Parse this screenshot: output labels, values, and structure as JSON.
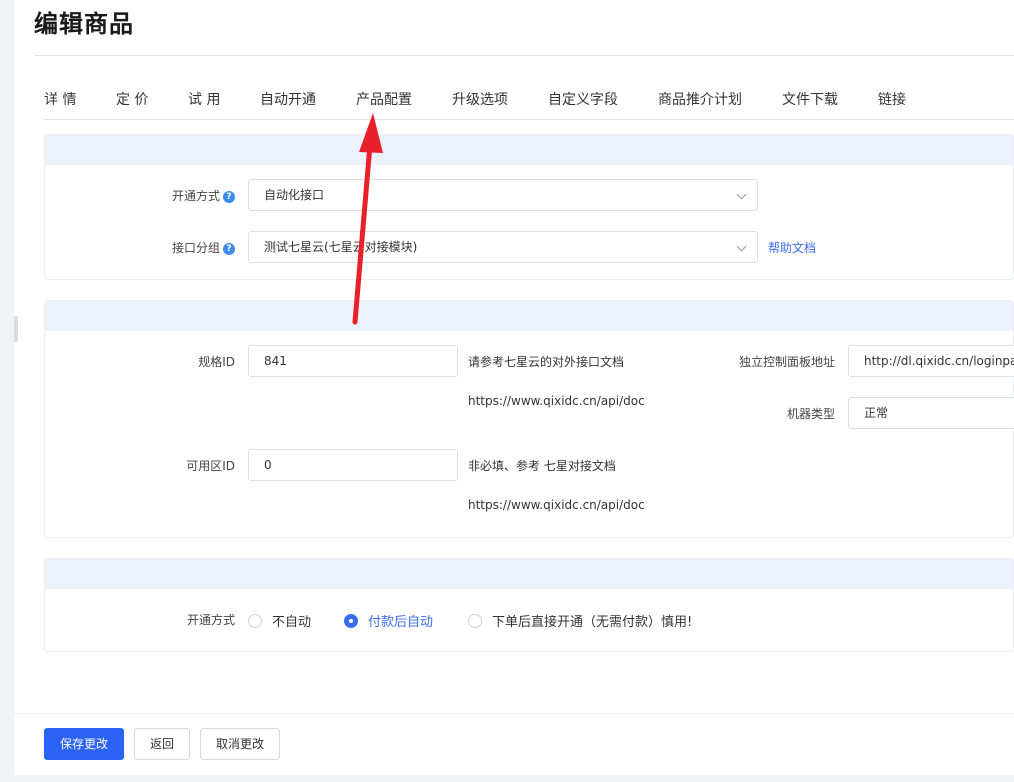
{
  "page": {
    "title": "编辑商品"
  },
  "tabs": [
    {
      "label": "详 情"
    },
    {
      "label": "定 价"
    },
    {
      "label": "试 用"
    },
    {
      "label": "自动开通",
      "active": true
    },
    {
      "label": "产品配置"
    },
    {
      "label": "升级选项"
    },
    {
      "label": "自定义字段"
    },
    {
      "label": "商品推介计划"
    },
    {
      "label": "文件下载"
    },
    {
      "label": "链接"
    }
  ],
  "section1": {
    "open_method": {
      "label": "开通方式",
      "value": "自动化接口"
    },
    "api_group": {
      "label": "接口分组",
      "value": "测试七星云(七星云对接模块)",
      "help_link": "帮助文档"
    }
  },
  "section2": {
    "spec_id": {
      "label": "规格ID",
      "value": "841",
      "note": "请参考七星云的对外接口文档",
      "url": "https://www.qixidc.cn/api/doc"
    },
    "zone_id": {
      "label": "可用区ID",
      "value": "0",
      "note": "非必填、参考 七星对接文档",
      "url": "https://www.qixidc.cn/api/doc"
    },
    "panel_url": {
      "label": "独立控制面板地址",
      "value": "http://dl.qixidc.cn/loginpanel"
    },
    "machine_type": {
      "label": "机器类型",
      "value": "正常"
    }
  },
  "section3": {
    "label": "开通方式",
    "options": [
      "不自动",
      "付款后自动",
      "下单后直接开通（无需付款）慎用!"
    ],
    "selected": 1
  },
  "footer": {
    "save": "保存更改",
    "back": "返回",
    "cancel": "取消更改"
  },
  "colors": {
    "accent": "#3b6cf2",
    "primary_button": "#2c62f5",
    "section_header": "#edf1fb",
    "annotation_arrow": "#e8202a"
  },
  "icons": {
    "help": "question-circle-icon",
    "dropdown": "chevron-down-icon",
    "annotation": "red-arrow-annotation"
  }
}
